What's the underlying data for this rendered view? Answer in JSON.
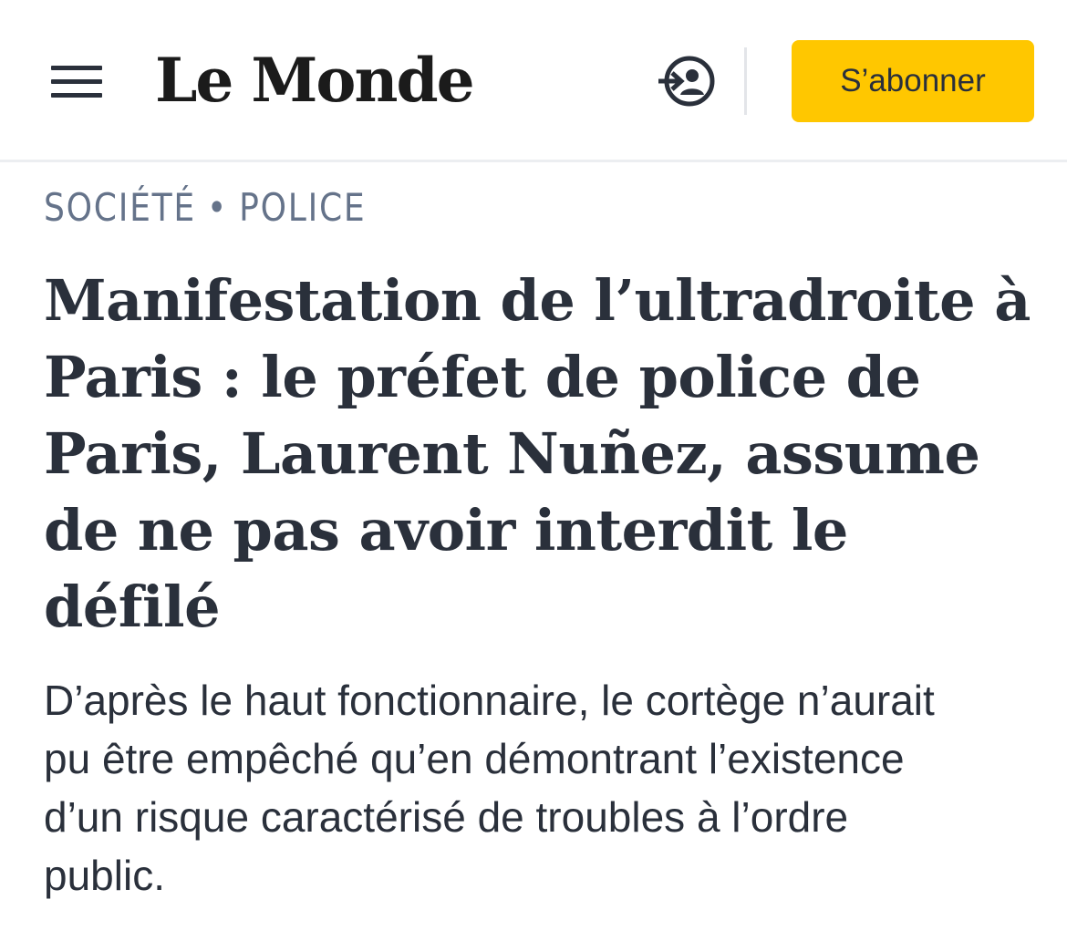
{
  "header": {
    "logo_text": "Le Monde",
    "menu_icon": "hamburger-menu-icon",
    "login_icon": "login-user-icon",
    "subscribe_label": "S’abonner",
    "colors": {
      "subscribe_bg": "#ffc700",
      "text": "#2a303b"
    }
  },
  "article": {
    "kicker": {
      "section": "SOCIÉTÉ",
      "separator": "•",
      "topic": "POLICE"
    },
    "title_lines": [
      "Manifestation de l’ultradroite à",
      "Paris : le préfet de police de",
      "Paris, Laurent Nuñez, assume",
      "de ne pas avoir interdit le",
      "défilé"
    ],
    "lede_lines": [
      "D’après le haut fonctionnaire, le cortège n’aurait",
      "pu être empêché qu’en démontrant l’existence",
      "d’un risque caractérisé de troubles à l’ordre",
      "public."
    ]
  }
}
